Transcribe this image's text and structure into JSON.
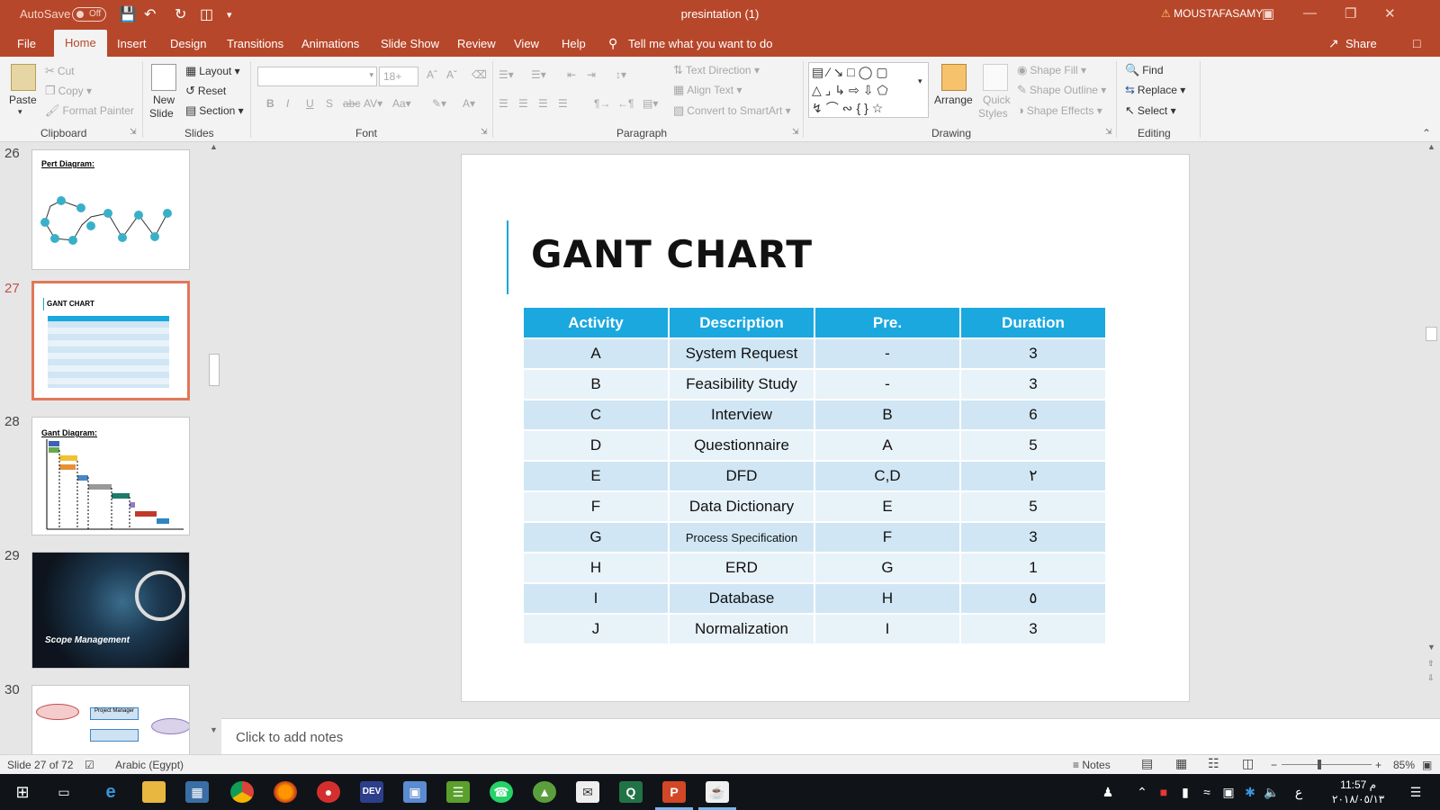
{
  "titlebar": {
    "autosave_label": "AutoSave",
    "autosave_state": "Off",
    "doc_title": "presintation (1)",
    "user": "MOUSTAFASAMY"
  },
  "tabs": [
    "File",
    "Home",
    "Insert",
    "Design",
    "Transitions",
    "Animations",
    "Slide Show",
    "Review",
    "View",
    "Help"
  ],
  "active_tab": "Home",
  "tell_me": "Tell me what you want to do",
  "share": "Share",
  "ribbon": {
    "clipboard": {
      "paste": "Paste",
      "cut": "Cut",
      "copy": "Copy",
      "format_painter": "Format Painter",
      "label": "Clipboard"
    },
    "slides": {
      "new_slide_1": "New",
      "new_slide_2": "Slide",
      "layout": "Layout",
      "reset": "Reset",
      "section": "Section",
      "label": "Slides"
    },
    "font": {
      "font_size": "18+",
      "label": "Font"
    },
    "paragraph": {
      "text_direction": "Text Direction",
      "align_text": "Align Text",
      "convert_smartart": "Convert to SmartArt",
      "label": "Paragraph"
    },
    "drawing": {
      "arrange": "Arrange",
      "quick_styles_1": "Quick",
      "quick_styles_2": "Styles",
      "shape_fill": "Shape Fill",
      "shape_outline": "Shape Outline",
      "shape_effects": "Shape Effects",
      "label": "Drawing"
    },
    "editing": {
      "find": "Find",
      "replace": "Replace",
      "select": "Select",
      "label": "Editing"
    }
  },
  "thumbnails": [
    {
      "num": "26",
      "title": "Pert Diagram:"
    },
    {
      "num": "27",
      "title": "GANT CHART"
    },
    {
      "num": "28",
      "title": "Gant Diagram:"
    },
    {
      "num": "29",
      "title": "Scope Management"
    },
    {
      "num": "30",
      "title": "Project Manager"
    }
  ],
  "slide": {
    "title": "GANT CHART",
    "table": {
      "headers": [
        "Activity",
        "Description",
        "Pre.",
        "Duration"
      ],
      "rows": [
        [
          "A",
          "System Request",
          "-",
          "3"
        ],
        [
          "B",
          "Feasibility Study",
          "-",
          "3"
        ],
        [
          "C",
          "Interview",
          "B",
          "6"
        ],
        [
          "D",
          "Questionnaire",
          "A",
          "5"
        ],
        [
          "E",
          "DFD",
          "C,D",
          "٢"
        ],
        [
          "F",
          "Data Dictionary",
          "E",
          "5"
        ],
        [
          "G",
          "Process Specification",
          "F",
          "3"
        ],
        [
          "H",
          "ERD",
          "G",
          "1"
        ],
        [
          "I",
          "Database",
          "H",
          "٥"
        ],
        [
          "J",
          "Normalization",
          "I",
          "3"
        ]
      ]
    }
  },
  "notes_placeholder": "Click to add notes",
  "statusbar": {
    "slide_info": "Slide 27 of 72",
    "language": "Arabic (Egypt)",
    "notes": "Notes",
    "zoom": "85%"
  },
  "taskbar": {
    "time": "11:57 م",
    "date": "٢٠١٨/٠٥/١٣",
    "lang": "ع"
  },
  "colors": {
    "accent": "#b7472a",
    "table_header": "#1ba8df",
    "title_accent": "#1aa6d5"
  }
}
